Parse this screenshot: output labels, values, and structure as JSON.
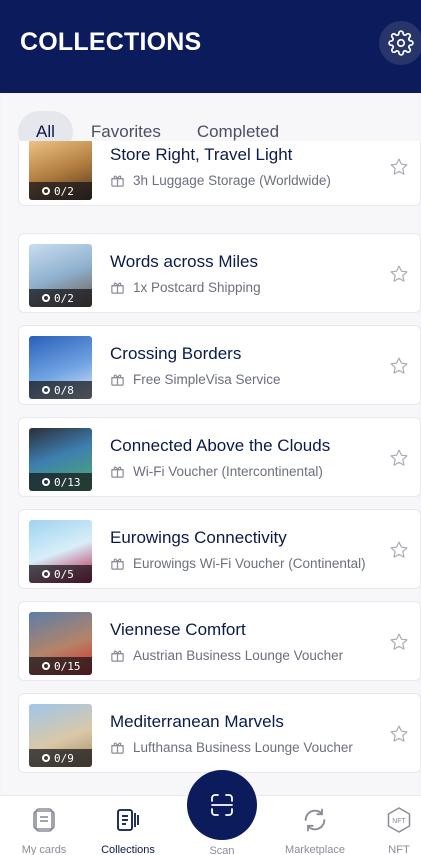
{
  "header": {
    "title": "COLLECTIONS",
    "settings_icon": "gear-icon"
  },
  "tabs": [
    {
      "label": "All",
      "active": true
    },
    {
      "label": "Favorites",
      "active": false
    },
    {
      "label": "Completed",
      "active": false
    }
  ],
  "collections": [
    {
      "title": "Store Right, Travel Light",
      "reward": "3h Luggage Storage (Worldwide)",
      "progress": "0/2"
    },
    {
      "title": "Words across Miles",
      "reward": "1x Postcard Shipping",
      "progress": "0/2"
    },
    {
      "title": "Crossing Borders",
      "reward": "Free SimpleVisa Service",
      "progress": "0/8"
    },
    {
      "title": "Connected Above the Clouds",
      "reward": "Wi-Fi Voucher (Intercontinental)",
      "progress": "0/13"
    },
    {
      "title": "Eurowings Connectivity",
      "reward": "Eurowings Wi-Fi Voucher (Continental)",
      "progress": "0/5"
    },
    {
      "title": "Viennese Comfort",
      "reward": "Austrian Business Lounge Voucher",
      "progress": "0/15"
    },
    {
      "title": "Mediterranean Marvels",
      "reward": "Lufthansa Business Lounge Voucher",
      "progress": "0/9"
    }
  ],
  "nav": {
    "my_cards": "My cards",
    "collections": "Collections",
    "scan": "Scan",
    "marketplace": "Marketplace",
    "nft": "NFT",
    "nft_icon_text": "NFT"
  },
  "colors": {
    "brand": "#0b1b5c",
    "accent_text": "#0a1a4a"
  }
}
